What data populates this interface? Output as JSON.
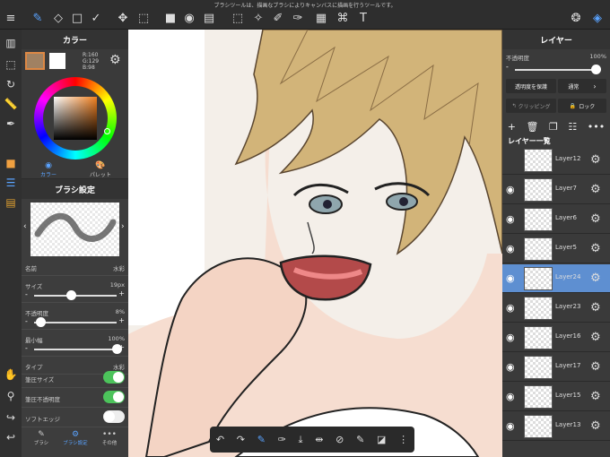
{
  "notice": "ブラシツールは、描画なブラシによりキャンバスに描画を行うツールです。",
  "color_panel": {
    "title": "カラー",
    "rgb_r": "R:160",
    "rgb_g": "G:129",
    "rgb_b": "B:98",
    "tab_color": "カラー",
    "tab_palette": "パレット",
    "primary_color": "#a08162"
  },
  "brush_panel": {
    "title": "ブラシ設定",
    "name_label": "名前",
    "name_value": "水彩",
    "size_label": "サイズ",
    "size_value": "19px",
    "size_fraction": 0.45,
    "opacity_label": "不透明度",
    "opacity_value": "8%",
    "opacity_fraction": 0.08,
    "min_width_label": "最小幅",
    "min_width_value": "100%",
    "min_width_fraction": 1.0,
    "type_label": "タイプ",
    "type_value": "水彩",
    "pressure_size_label": "筆圧サイズ",
    "pressure_size_on": true,
    "pressure_opacity_label": "筆圧不透明度",
    "pressure_opacity_on": true,
    "soft_edge_label": "ソフトエッジ",
    "soft_edge_on": false,
    "tab_brush": "ブラシ",
    "tab_brush_settings": "ブラシ設定",
    "tab_other": "その他"
  },
  "layer_panel": {
    "title": "レイヤー",
    "opacity_label": "不透明度",
    "opacity_value": "100%",
    "opacity_fraction": 1.0,
    "protect_label": "透明度を保護",
    "blend_label": "通常",
    "clipping_label": "クリッピング",
    "lock_label": "ロック",
    "list_title": "レイヤー一覧",
    "layers": [
      {
        "name": "Layer12",
        "visible": false,
        "selected": false
      },
      {
        "name": "Layer7",
        "visible": true,
        "selected": false
      },
      {
        "name": "Layer6",
        "visible": true,
        "selected": false
      },
      {
        "name": "Layer5",
        "visible": true,
        "selected": false
      },
      {
        "name": "Layer24",
        "visible": true,
        "selected": true
      },
      {
        "name": "Layer23",
        "visible": true,
        "selected": false
      },
      {
        "name": "Layer16",
        "visible": true,
        "selected": false
      },
      {
        "name": "Layer17",
        "visible": true,
        "selected": false
      },
      {
        "name": "Layer15",
        "visible": true,
        "selected": false
      },
      {
        "name": "Layer13",
        "visible": true,
        "selected": false
      }
    ]
  },
  "colors": {
    "accent": "#5aa3ff",
    "selected_layer": "#5e8fd1",
    "toggle_on": "#4cc35b",
    "hair": "#d2b479",
    "skin": "#f6ddd0"
  }
}
